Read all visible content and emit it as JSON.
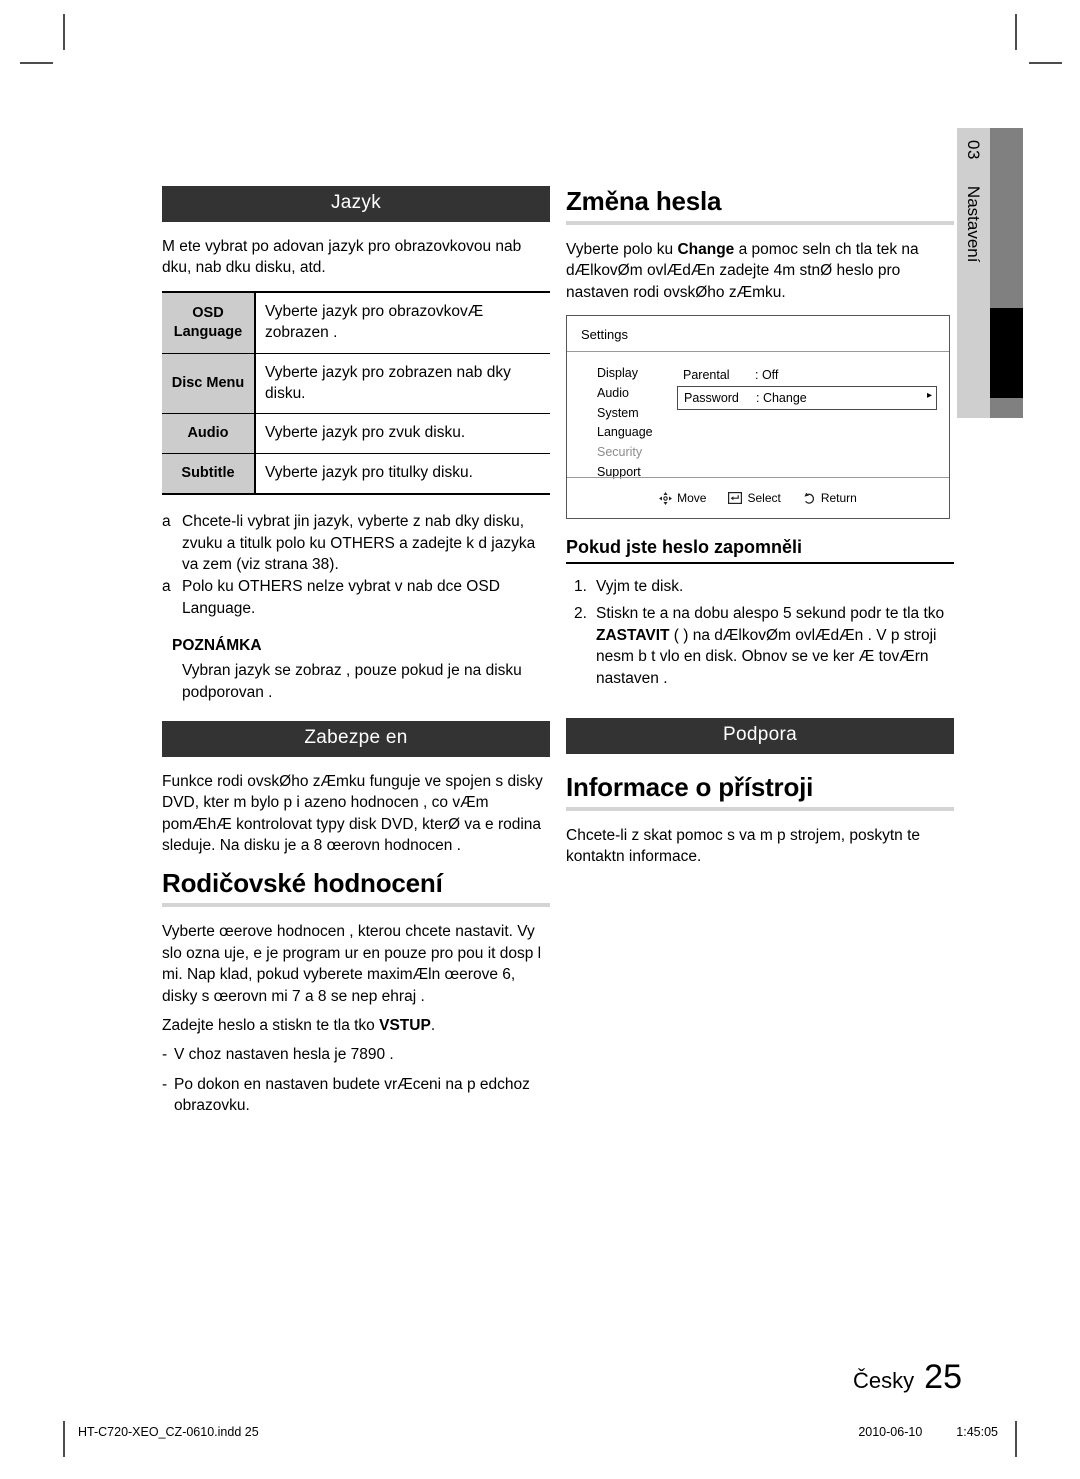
{
  "chapter_tab": {
    "number": "03",
    "label": "Nastavení"
  },
  "left_column": {
    "section_jazyk": {
      "bar_label": "Jazyk",
      "intro": "M ete vybrat po adovan  jazyk pro obrazovkovou nab dku, nab dku disku, atd.",
      "table": {
        "rows": [
          {
            "key": "OSD\nLanguage",
            "value": "Vyberte jazyk pro obrazovkovÆ zobrazen ."
          },
          {
            "key": "Disc Menu",
            "value": "Vyberte jazyk pro zobrazen  nab dky disku."
          },
          {
            "key": "Audio",
            "value": "Vyberte jazyk pro zvuk disku."
          },
          {
            "key": "Subtitle",
            "value": "Vyberte jazyk pro titulky disku."
          }
        ]
      },
      "bullets": [
        {
          "mark": "a",
          "text": "Chcete-li vybrat jin  jazyk, vyberte z nab dky disku, zvuku a titulk  polo ku OTHERS a zadejte k d jazyka va  zem  (viz strana 38)."
        },
        {
          "mark": "a",
          "text": "Polo ku OTHERS nelze vybrat v nab dce OSD Language."
        }
      ],
      "note": {
        "title": "POZNÁMKA",
        "body": "Vybran  jazyk se zobraz , pouze pokud je na disku podporovan ."
      }
    },
    "section_zabezpeceni": {
      "bar_label": "Zabezpe en",
      "intro": "Funkce rodi ovskØho zÆmku funguje ve spojen  s disky DVD, kter m bylo p i azeno hodnocen , co  vÆm pomÆhÆ kontrolovat typy disk  DVD, kterØ va e rodina sleduje. Na disku je a  8 œerovn  hodnocen .",
      "heading": "Rodičovské hodnocení",
      "paragraph1": "Vyberte œerove  hodnocen , kterou chcete nastavit. Vy    slo ozna uje,  e je program ur en pouze pro pou it  dosp l mi. Nap klad, pokud vyberete maximÆln  œerove  6, disky s œerovn mi 7 a 8 se nep ehraj .",
      "paragraph2_pre": "Zadejte heslo a stiskn te tla tko ",
      "paragraph2_bold": "VSTUP",
      "paragraph2_post": ".",
      "dashes": [
        "V choz  nastaven  hesla je  7890 .",
        "Po dokon en  nastaven  budete vrÆceni na p edchoz  obrazovku."
      ]
    }
  },
  "right_column": {
    "section_zmena_hesla": {
      "heading": "Změna hesla",
      "paragraph_pre": "Vyberte polo ku ",
      "paragraph_bold": "Change",
      "paragraph_post": " a pomoc    seln ch tla tek na dÆlkovØm ovlÆdÆn  zadejte 4m stnØ heslo pro nastaven  rodi ovskØho zÆmku.",
      "osd": {
        "title": "Settings",
        "menu": [
          {
            "label": "Display",
            "dim": false
          },
          {
            "label": "Audio",
            "dim": false
          },
          {
            "label": "System",
            "dim": false
          },
          {
            "label": "Language",
            "dim": false
          },
          {
            "label": "Security",
            "dim": true
          },
          {
            "label": "Support",
            "dim": false
          }
        ],
        "settings": [
          {
            "name": "Parental",
            "value": ": Off",
            "boxed": false,
            "arrow": ""
          },
          {
            "name": "Password",
            "value": ": Change",
            "boxed": true,
            "arrow": "▸"
          }
        ],
        "hints": [
          {
            "icon": "move-dpad-icon",
            "label": "Move"
          },
          {
            "icon": "enter-key-icon",
            "label": "Select"
          },
          {
            "icon": "return-arrow-icon",
            "label": "Return"
          }
        ]
      },
      "sub_heading": "Pokud jste heslo zapomněli",
      "steps": [
        {
          "num": "1.",
          "text": "Vyjm te disk."
        },
        {
          "num": "2.",
          "text_pre": "Stiskn te a na dobu alespo  5 sekund podr te tla tko ",
          "text_bold": "ZASTAVIT",
          "text_post": " (  ) na dÆlkovØm ovlÆdÆn . V p stroji nesm  b t vlo en disk. Obnov  se ve ker Æ tovÆrn  nastaven ."
        }
      ]
    },
    "section_podpora": {
      "bar_label": "Podpora",
      "heading": "Informace o přístroji",
      "paragraph": "Chcete-li z skat pomoc s va  m p strojem, poskytn te kontaktn  informace."
    }
  },
  "footer": {
    "language": "Česky",
    "page_number": "25",
    "file_name": "HT-C720-XEO_CZ-0610.indd   25",
    "date": "2010-06-10",
    "time": "1:45:05"
  },
  "colors": {
    "section_bar": "#333333",
    "table_key_cell": "#cccccc",
    "rule_gray": "#d4d4d4",
    "tab_background": "#cfcfcf",
    "tab_mark_gray": "#808080",
    "tab_mark_black": "#000000"
  }
}
